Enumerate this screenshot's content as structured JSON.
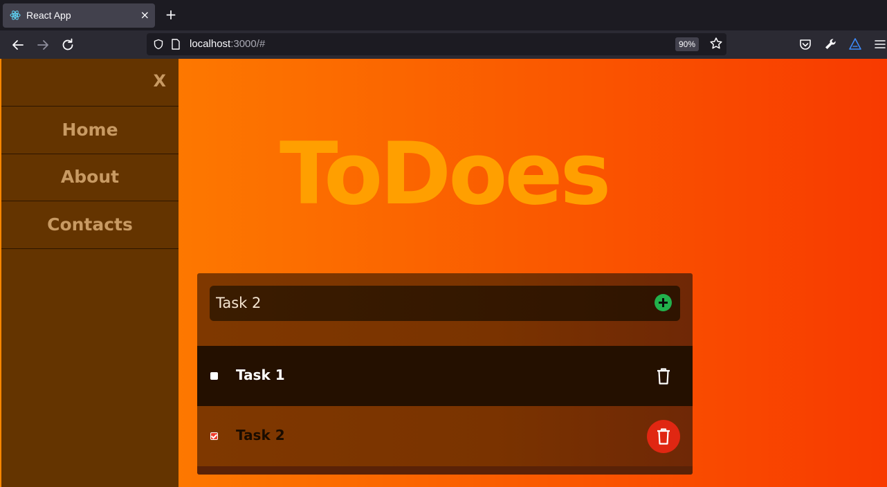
{
  "browser": {
    "tab_title": "React App",
    "tab_close_glyph": "×",
    "new_tab_glyph": "+",
    "url_host": "localhost",
    "url_rest": ":3000/#",
    "zoom": "90%",
    "icons": [
      "react-favicon-icon",
      "back-icon",
      "forward-icon",
      "reload-icon",
      "shield-icon",
      "page-icon",
      "bookmark-star-icon",
      "pocket-icon",
      "wrench-icon",
      "extension-icon",
      "menu-icon"
    ]
  },
  "sidebar": {
    "close_label": "X",
    "items": [
      {
        "label": "Home"
      },
      {
        "label": "About"
      },
      {
        "label": "Contacts"
      }
    ]
  },
  "main": {
    "title": "ToDoes",
    "input": {
      "value": "Task 2"
    },
    "tasks": [
      {
        "label": "Task 1",
        "checked": false
      },
      {
        "label": "Task 2",
        "checked": true
      }
    ]
  },
  "colors": {
    "sidebar_bg": "#643400",
    "sidebar_text": "#c89a63",
    "title": "#ff9f00",
    "add_button": "#22b14c",
    "delete_active": "#e02712",
    "gradient_start": "#ff8600",
    "gradient_end": "#f83a00"
  }
}
